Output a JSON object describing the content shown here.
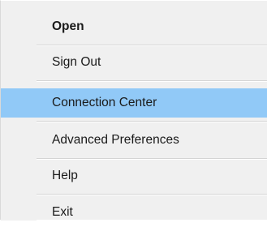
{
  "context_menu": {
    "items": [
      {
        "label": "Open",
        "bold": true,
        "highlighted": false
      },
      {
        "label": "Sign Out",
        "bold": false,
        "highlighted": false
      },
      {
        "label": "Connection Center",
        "bold": false,
        "highlighted": true
      },
      {
        "label": "Advanced Preferences",
        "bold": false,
        "highlighted": false
      },
      {
        "label": "Help",
        "bold": false,
        "highlighted": false
      },
      {
        "label": "Exit",
        "bold": false,
        "highlighted": false
      }
    ],
    "colors": {
      "background": "#f0f0f0",
      "highlight": "#91c9f7",
      "separator": "#d4d4d4",
      "text": "#1a1a1a"
    }
  }
}
